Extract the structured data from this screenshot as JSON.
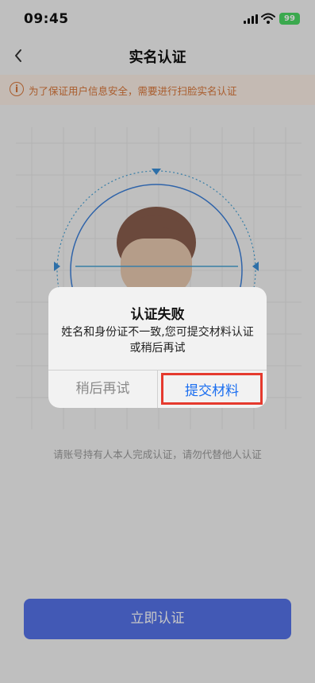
{
  "status_bar": {
    "time": "09:45",
    "battery": "99"
  },
  "nav": {
    "title": "实名认证",
    "back_icon": "chevron-left-icon"
  },
  "notice": {
    "icon": "info-icon",
    "text": "为了保证用户信息安全，需要进行扫脸实名认证"
  },
  "hint": "请账号持有人本人完成认证，请勿代替他人认证",
  "primary_button": "立即认证",
  "dialog": {
    "title": "认证失败",
    "message": "姓名和身份证不一致,您可提交材料认证或稍后再试",
    "later_label": "稍后再试",
    "submit_label": "提交材料"
  },
  "colors": {
    "accent": "#5572e8",
    "warning": "#d9773a",
    "highlight": "#e53a2e",
    "link": "#1a6ef0"
  }
}
